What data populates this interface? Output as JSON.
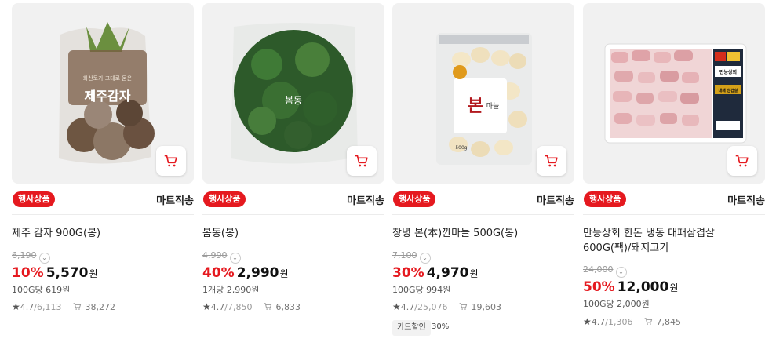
{
  "products": [
    {
      "name": "제주 감자 900G(봉)",
      "badge": "행사상품",
      "shipping": "마트직송",
      "original_price": "6,190",
      "discount_rate": "10%",
      "sale_price": "5,570",
      "currency": "원",
      "unit_price": "100G당 619원",
      "rating": "4.7",
      "reviews": "/6,113",
      "cart_count": "38,272",
      "image_text": [
        "화산토가 그대로 묻은",
        "제주감자"
      ]
    },
    {
      "name": "봄동(봉)",
      "badge": "행사상품",
      "shipping": "마트직송",
      "original_price": "4,990",
      "discount_rate": "40%",
      "sale_price": "2,990",
      "currency": "원",
      "unit_price": "1개당 2,990원",
      "rating": "4.7",
      "reviews": "/7,850",
      "cart_count": "6,833",
      "image_text": [
        "봄동"
      ]
    },
    {
      "name": "창녕 본(本)깐마늘 500G(봉)",
      "badge": "행사상품",
      "shipping": "마트직송",
      "original_price": "7,100",
      "discount_rate": "30%",
      "sale_price": "4,970",
      "currency": "원",
      "unit_price": "100G당 994원",
      "rating": "4.7",
      "reviews": "/25,076",
      "cart_count": "19,603",
      "card_tag": "카드할인",
      "card_tag_value": "30%",
      "image_text": [
        "본",
        "마늘",
        "500g"
      ]
    },
    {
      "name": "만능상회 한돈 냉동 대패삼겹살 600G(팩)/돼지고기",
      "badge": "행사상품",
      "shipping": "마트직송",
      "original_price": "24,000",
      "discount_rate": "50%",
      "sale_price": "12,000",
      "currency": "원",
      "unit_price": "100G당 2,000원",
      "rating": "4.7",
      "reviews": "/1,306",
      "cart_count": "7,845",
      "image_text": [
        "만능상회",
        "대패 삼겹살"
      ]
    }
  ],
  "icons": {
    "cart": "shopping-cart-icon",
    "star": "star-icon",
    "cart_stat": "cart-count-icon",
    "chevron": "chevron-down-icon"
  },
  "colors": {
    "accent": "#e5191f",
    "badge_bg": "#e5191f",
    "thumb_bg": "#f1f1f1"
  }
}
